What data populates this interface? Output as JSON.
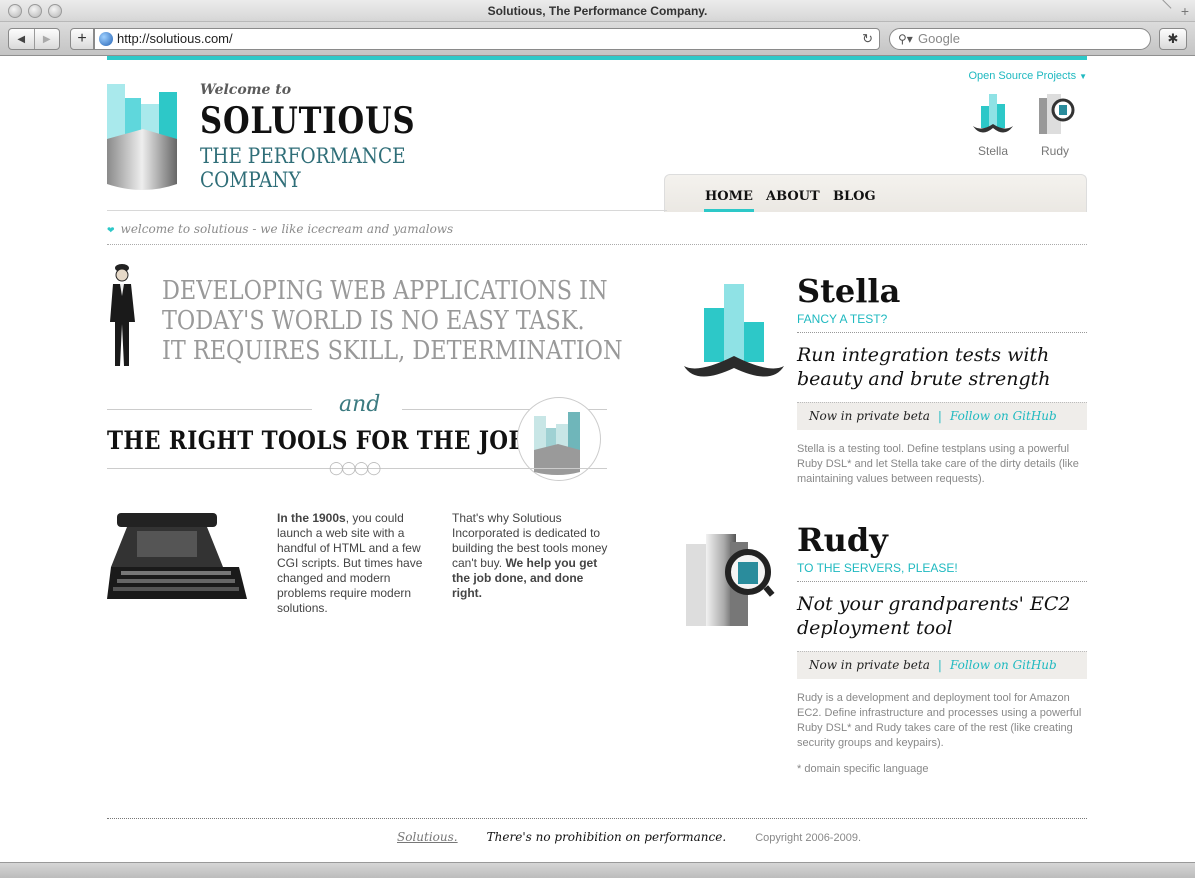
{
  "browser": {
    "window_title": "Solutious, The Performance Company.",
    "url": "http://solutious.com/",
    "search_placeholder": "Google"
  },
  "header": {
    "open_source_label": "Open Source Projects",
    "welcome": "Welcome to",
    "brand": "SOLUTIOUS",
    "tagline_line1": "THE PERFORMANCE",
    "tagline_line2": "COMPANY",
    "projects": [
      {
        "label": "Stella"
      },
      {
        "label": "Rudy"
      }
    ],
    "nav": [
      {
        "label": "HOME",
        "active": true
      },
      {
        "label": "ABOUT",
        "active": false
      },
      {
        "label": "BLOG",
        "active": false
      }
    ],
    "breadcrumb": "welcome to solutious - we like icecream and yamalows"
  },
  "intro": {
    "headline_line1": "DEVELOPING WEB APPLICATIONS IN",
    "headline_line2": "TODAY'S WORLD IS NO EASY TASK.",
    "headline_line3": "IT REQUIRES SKILL, DETERMINATION",
    "and": "and",
    "right_tools": "THE RIGHT TOOLS FOR THE JOB.",
    "col1_bold": "In the 1900s",
    "col1_rest": ", you could launch a web site with a handful of HTML and a few CGI scripts. But times have changed and modern problems require modern solutions.",
    "col2_text": "That's why Solutious Incorporated is dedicated to building the best tools money can't buy. ",
    "col2_bold": "We help you get the job done, and done right."
  },
  "products": [
    {
      "name": "Stella",
      "subtitle": "FANCY A TEST?",
      "lead": "Run integration tests with beauty and brute strength",
      "status": "Now in private beta",
      "github": "Follow on GitHub",
      "description": "Stella is a testing tool. Define testplans using a powerful Ruby DSL* and let Stella take care of the dirty details (like maintaining values between requests)."
    },
    {
      "name": "Rudy",
      "subtitle": "TO THE SERVERS, PLEASE!",
      "lead": "Not your grandparents' EC2 deployment tool",
      "status": "Now in private beta",
      "github": "Follow on GitHub",
      "description": "Rudy is a development and deployment tool for Amazon EC2. Define infrastructure and processes using a powerful Ruby DSL* and Rudy takes care of the rest (like creating security groups and keypairs).",
      "footnote": "* domain specific language"
    }
  ],
  "footer": {
    "brand": "Solutious.",
    "quote": "There's no prohibition on performance.",
    "copyright": "Copyright 2006-2009."
  },
  "colors": {
    "accent": "#2dc8c8",
    "link": "#1fb9c0",
    "tagline": "#2f6e78"
  }
}
